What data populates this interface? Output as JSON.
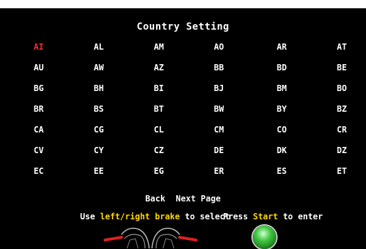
{
  "screen": {
    "title": "Country Setting",
    "selected": "AI",
    "countries": [
      [
        "AI",
        "AL",
        "AM",
        "AO",
        "AR",
        "AT"
      ],
      [
        "AU",
        "AW",
        "AZ",
        "BB",
        "BD",
        "BE"
      ],
      [
        "BG",
        "BH",
        "BI",
        "BJ",
        "BM",
        "BO"
      ],
      [
        "BR",
        "BS",
        "BT",
        "BW",
        "BY",
        "BZ"
      ],
      [
        "CA",
        "CG",
        "CL",
        "CM",
        "CO",
        "CR"
      ],
      [
        "CV",
        "CY",
        "CZ",
        "DE",
        "DK",
        "DZ"
      ],
      [
        "EC",
        "EE",
        "EG",
        "ER",
        "ES",
        "ET"
      ]
    ]
  },
  "nav": {
    "back_label": "Back",
    "next_label": "Next Page"
  },
  "hint": {
    "left_prefix": "Use ",
    "left_highlight": "left/right brake",
    "left_suffix": " to select",
    "right_prefix": "Press ",
    "right_highlight": "Start",
    "right_suffix": " to enter"
  },
  "colors": {
    "selected": "#ff2a2a",
    "highlight": "#ffd700",
    "background": "#000000"
  },
  "icons": {
    "brake_left": "left-brake-lever-icon",
    "brake_right": "right-brake-lever-icon",
    "start": "start-button-icon"
  }
}
